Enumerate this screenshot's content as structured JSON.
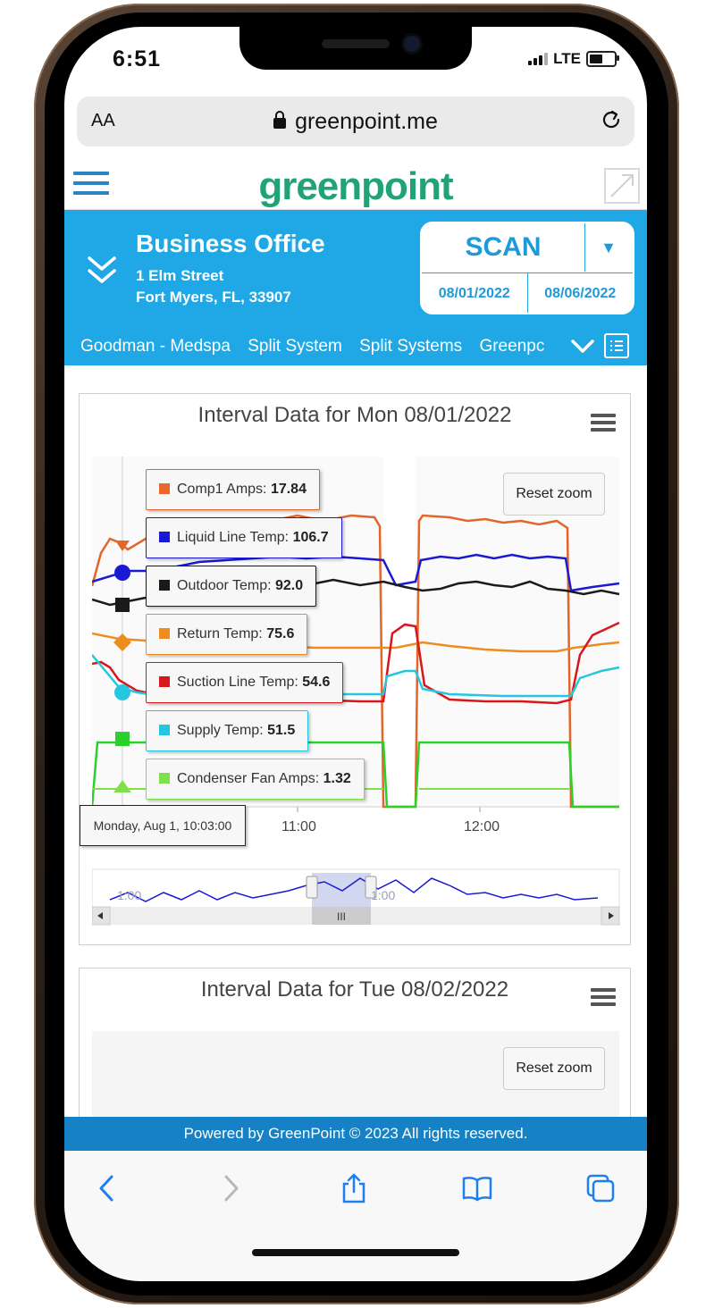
{
  "status_bar": {
    "time": "6:51",
    "network": "LTE"
  },
  "browser": {
    "aa_label": "AA",
    "url": "greenpoint.me"
  },
  "site": {
    "logo_text": "greenpoint"
  },
  "location": {
    "name": "Business Office",
    "address_line1": "1 Elm Street",
    "address_line2": "Fort Myers, FL, 33907"
  },
  "scan": {
    "label": "SCAN",
    "dropdown": "▼",
    "start_date": "08/01/2022",
    "end_date": "08/06/2022"
  },
  "tabs": [
    "Goodman - Medspa",
    "Split System",
    "Split Systems",
    "Greenpc"
  ],
  "chart1": {
    "title": "Interval Data for Mon 08/01/2022",
    "reset_zoom": "Reset zoom",
    "x_tooltip": "Monday, Aug 1, 10:03:00",
    "x_ticks": [
      "11:00",
      "12:00"
    ],
    "navigator_labels": [
      "1:00",
      "1:00"
    ],
    "navigator_handle": "III",
    "tooltips": [
      {
        "label": "Comp1 Amps: ",
        "value": "17.84",
        "color": "#e8672a"
      },
      {
        "label": "Liquid Line Temp: ",
        "value": "106.7",
        "color": "#1a1ad4"
      },
      {
        "label": "Outdoor Temp: ",
        "value": "92.0",
        "color": "#1a1a1a"
      },
      {
        "label": "Return Temp: ",
        "value": "75.6",
        "color": "#ef8c1e"
      },
      {
        "label": "Suction Line Temp: ",
        "value": "54.6",
        "color": "#d9161c"
      },
      {
        "label": "Supply Temp: ",
        "value": "51.5",
        "color": "#25c7e0"
      },
      {
        "label": "Condenser Fan Amps: ",
        "value": "1.32",
        "color": "#7fe04a"
      }
    ]
  },
  "chart2": {
    "title": "Interval Data for Tue 08/02/2022",
    "reset_zoom": "Reset zoom"
  },
  "footer": {
    "text": "Powered by GreenPoint © 2023 All rights reserved."
  },
  "colors": {
    "brand_blue": "#1fa8e5",
    "logo_green": "#21a37a",
    "footer_blue": "#1681c4"
  }
}
